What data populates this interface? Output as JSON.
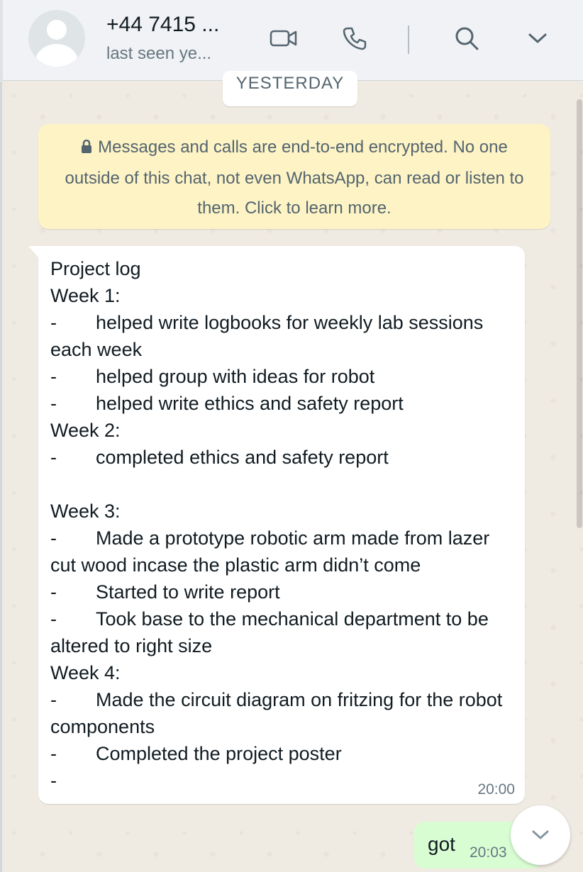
{
  "header": {
    "contact_name": "+44 7415 ...",
    "status": "last seen ye...",
    "icons": [
      "video-call-icon",
      "voice-call-icon",
      "search-icon",
      "chevron-down-icon"
    ]
  },
  "chat": {
    "date_chip": "YESTERDAY",
    "encryption_notice": "Messages and calls are end-to-end encrypted. No one outside of this chat, not even WhatsApp, can read or listen to them. Click to learn more.",
    "messages": [
      {
        "direction": "incoming",
        "text": "Project log\nWeek 1:\n-\thelped write logbooks for weekly lab sessions each week\n-\thelped group with ideas for robot\n-\thelped write ethics and safety report\nWeek 2:\n-\tcompleted ethics and safety report\n\nWeek 3:\n-\tMade a prototype robotic arm made from lazer cut wood incase the plastic arm didn’t come\n-\tStarted to write report\n-\tTook base to the mechanical department to be altered to right size\nWeek 4:\n-\tMade the circuit diagram on fritzing for the robot components\n-\tCompleted the project poster\n-",
        "time": "20:00"
      },
      {
        "direction": "outgoing",
        "text": "got",
        "time": "20:03"
      }
    ]
  },
  "colors": {
    "header_bg": "#f0f2f5",
    "chat_bg": "#efeae2",
    "encryption_bg": "#fdf3c5",
    "outgoing_bubble": "#d9fdd3",
    "incoming_bubble": "#ffffff"
  }
}
